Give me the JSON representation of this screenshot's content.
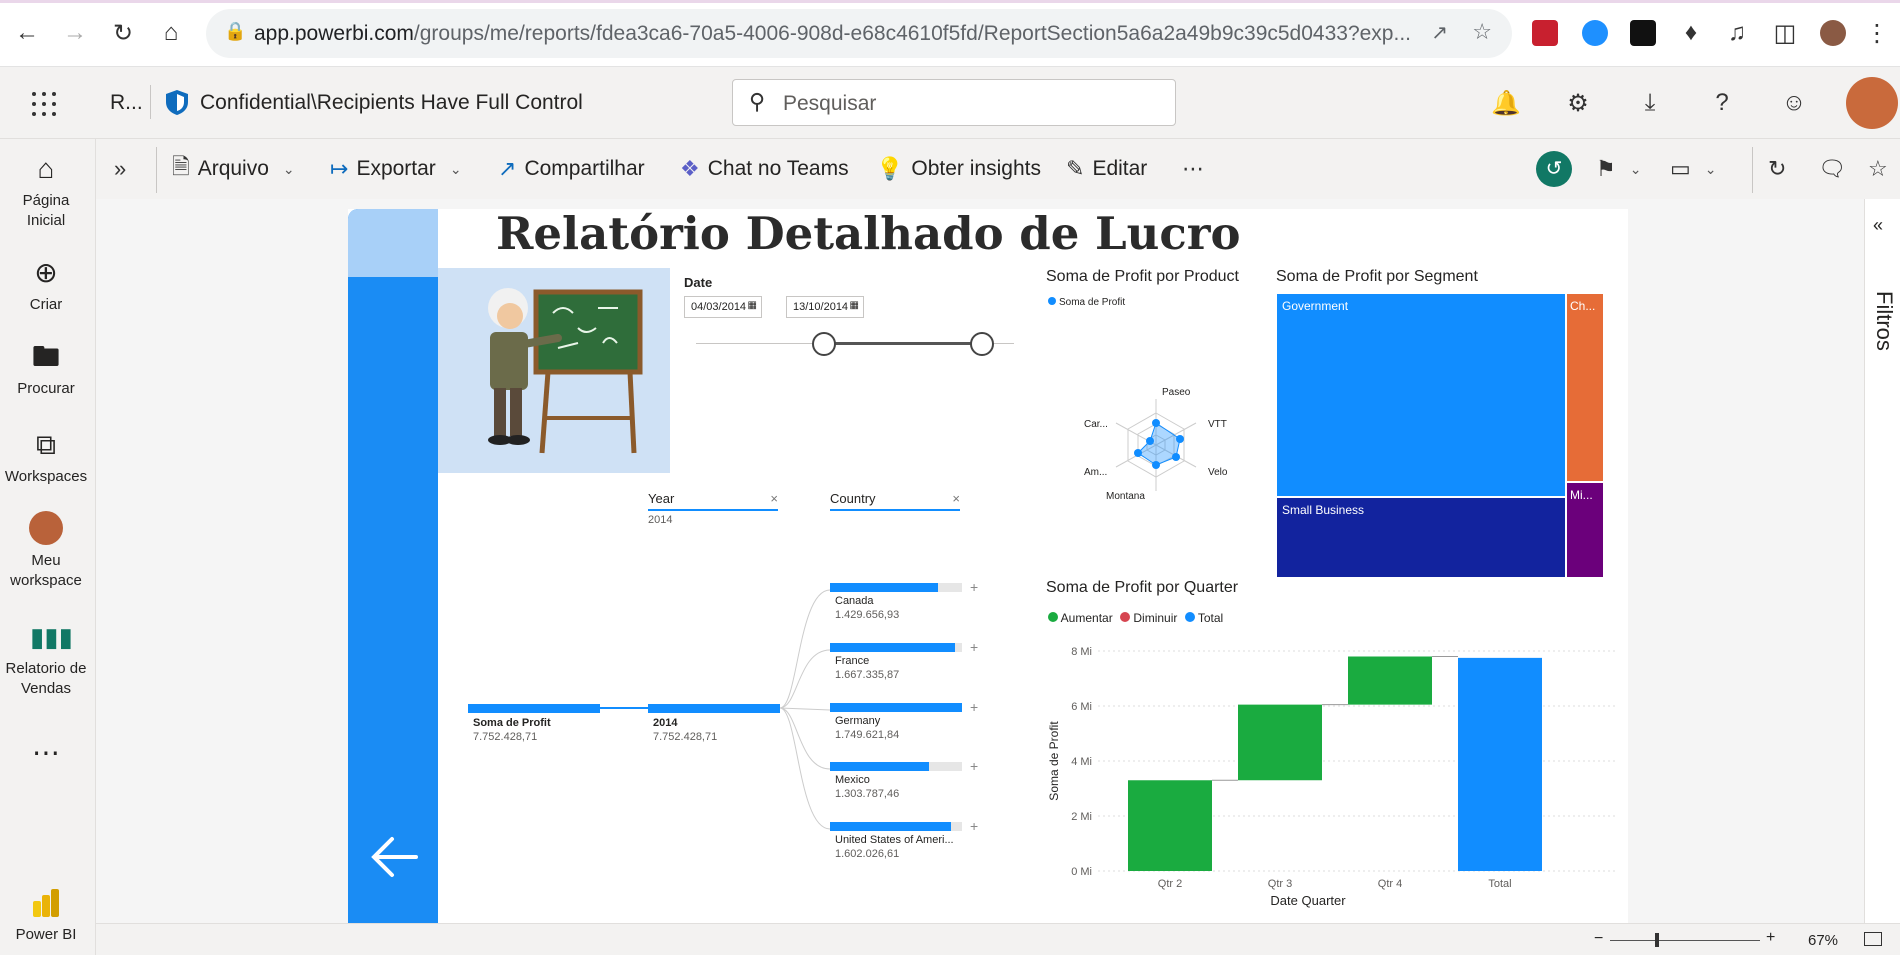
{
  "browser": {
    "url_host": "app.powerbi.com",
    "url_path": "/groups/me/reports/fdea3ca6-70a5-4006-908d-e68c4610f5fd/ReportSection5a6a2a49b9c39c5d0433?exp..."
  },
  "header": {
    "app_short": "R...",
    "sensitivity": "Confidential\\Recipients Have Full Control",
    "search_placeholder": "Pesquisar"
  },
  "left_nav": [
    {
      "label_1": "Página",
      "label_2": "Inicial",
      "icon": "home-icon"
    },
    {
      "label_1": "Criar",
      "label_2": "",
      "icon": "plus-circle-icon"
    },
    {
      "label_1": "Procurar",
      "label_2": "",
      "icon": "folder-icon"
    },
    {
      "label_1": "Workspaces",
      "label_2": "",
      "icon": "workspaces-icon"
    },
    {
      "label_1": "Meu",
      "label_2": "workspace",
      "icon": "avatar"
    },
    {
      "label_1": "Relatorio de",
      "label_2": "Vendas",
      "icon": "report-icon"
    }
  ],
  "left_nav_bottom": "Power BI",
  "action_bar": {
    "arquivo": "Arquivo",
    "exportar": "Exportar",
    "compartilhar": "Compartilhar",
    "teams": "Chat no Teams",
    "insights": "Obter insights",
    "editar": "Editar"
  },
  "report": {
    "title": "Relatório Detalhado de Lucro",
    "date_slicer": {
      "label": "Date",
      "start": "04/03/2014",
      "end": "13/10/2014"
    },
    "year_filter": {
      "label": "Year",
      "value": "2014"
    },
    "country_filter": {
      "label": "Country"
    },
    "decomp": {
      "root_label": "Soma de Profit",
      "root_value": "7.752.428,71",
      "year_label": "2014",
      "year_value": "7.752.428,71",
      "countries": [
        {
          "name": "Canada",
          "value": "1.429.656,93",
          "fill": 0.82
        },
        {
          "name": "France",
          "value": "1.667.335,87",
          "fill": 0.95
        },
        {
          "name": "Germany",
          "value": "1.749.621,84",
          "fill": 1.0
        },
        {
          "name": "Mexico",
          "value": "1.303.787,46",
          "fill": 0.75
        },
        {
          "name": "United States of Ameri...",
          "value": "1.602.026,61",
          "fill": 0.92
        }
      ]
    },
    "radar": {
      "title": "Soma de Profit por Product",
      "legend": "Soma de Profit",
      "labels": [
        "Paseo",
        "VTT",
        "Velo",
        "Montana",
        "Am...",
        "Car..."
      ]
    },
    "treemap": {
      "title": "Soma de Profit por Segment",
      "tiles": [
        "Government",
        "Ch...",
        "Small Business",
        "Mi..."
      ],
      "colors": [
        "#118dff",
        "#e66c37",
        "#12239e",
        "#6b007b"
      ]
    },
    "waterfall": {
      "title": "Soma de Profit por Quarter",
      "legend": [
        "Aumentar",
        "Diminuir",
        "Total"
      ],
      "legend_colors": [
        "#1aab40",
        "#d64550",
        "#118dff"
      ],
      "ylabel": "Soma de Profit",
      "xlabel": "Date Quarter",
      "yticks": [
        "8 Mi",
        "6 Mi",
        "4 Mi",
        "2 Mi",
        "0 Mi"
      ]
    }
  },
  "chart_data": {
    "type": "bar",
    "title": "Soma de Profit por Quarter",
    "xlabel": "Date Quarter",
    "ylabel": "Soma de Profit",
    "categories": [
      "Qtr 2",
      "Qtr 3",
      "Qtr 4",
      "Total"
    ],
    "series": [
      {
        "name": "Aumentar",
        "values": [
          3.3,
          2.75,
          1.75,
          null
        ]
      },
      {
        "name": "Total",
        "values": [
          null,
          null,
          null,
          7.75
        ]
      }
    ],
    "ylim": [
      0,
      8
    ],
    "grid": true,
    "legend": "top-left"
  },
  "filters_label": "Filtros",
  "zoom": "67%"
}
